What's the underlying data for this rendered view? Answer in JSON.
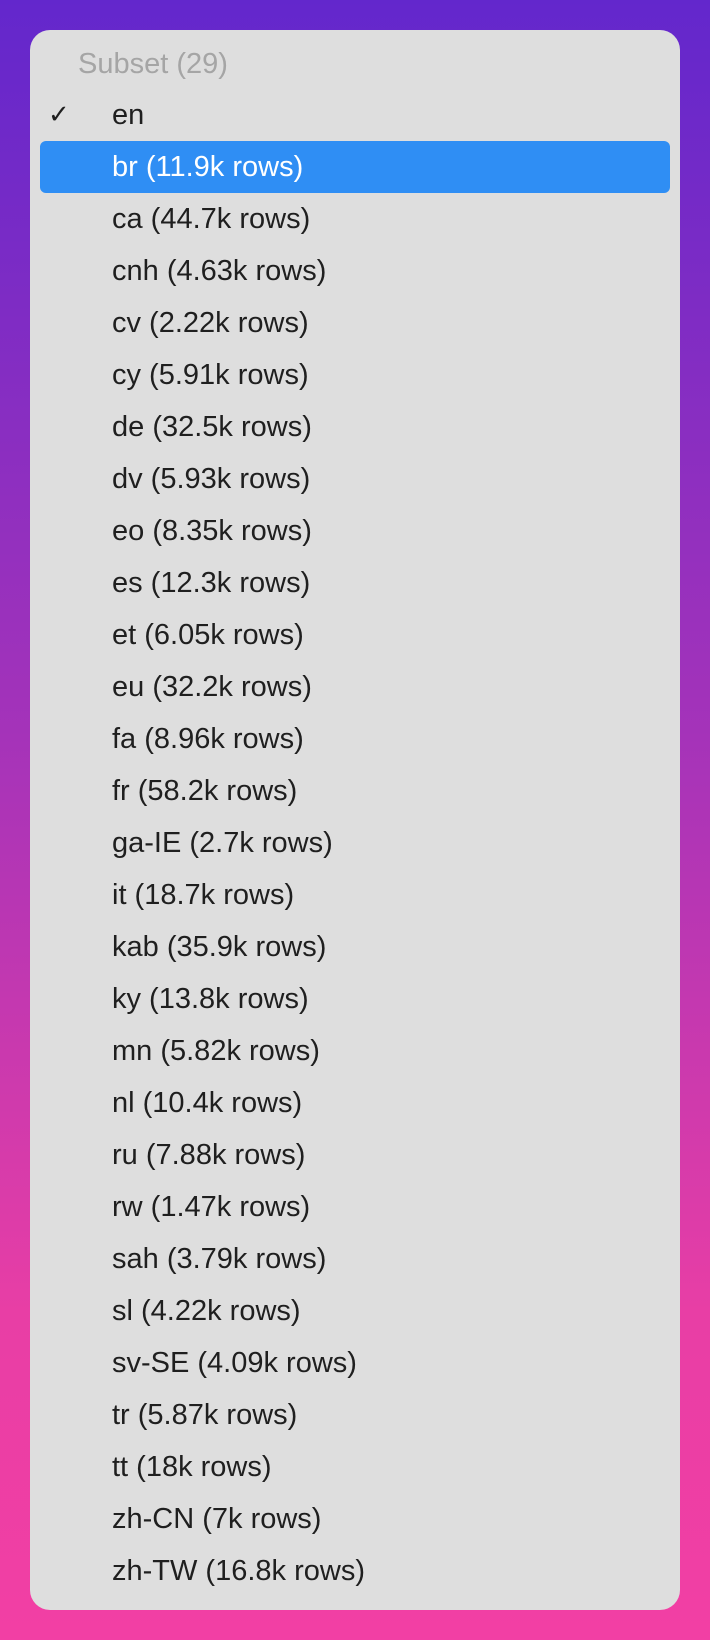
{
  "dropdown": {
    "header": "Subset (29)",
    "checked_index": 0,
    "highlighted_index": 1,
    "check_glyph": "✓",
    "colors": {
      "panel": "#DEDEDE",
      "highlight": "#2F8EF4",
      "text": "#1F1F1F",
      "header_text": "#A5A5A5",
      "background_top": "#6327CC",
      "background_bottom": "#F23FA4"
    },
    "items": [
      {
        "label": "en"
      },
      {
        "label": "br (11.9k rows)"
      },
      {
        "label": "ca (44.7k rows)"
      },
      {
        "label": "cnh (4.63k rows)"
      },
      {
        "label": "cv (2.22k rows)"
      },
      {
        "label": "cy (5.91k rows)"
      },
      {
        "label": "de (32.5k rows)"
      },
      {
        "label": "dv (5.93k rows)"
      },
      {
        "label": "eo (8.35k rows)"
      },
      {
        "label": "es (12.3k rows)"
      },
      {
        "label": "et (6.05k rows)"
      },
      {
        "label": "eu (32.2k rows)"
      },
      {
        "label": "fa (8.96k rows)"
      },
      {
        "label": "fr (58.2k rows)"
      },
      {
        "label": "ga-IE (2.7k rows)"
      },
      {
        "label": "it (18.7k rows)"
      },
      {
        "label": "kab (35.9k rows)"
      },
      {
        "label": "ky (13.8k rows)"
      },
      {
        "label": "mn (5.82k rows)"
      },
      {
        "label": "nl (10.4k rows)"
      },
      {
        "label": "ru (7.88k rows)"
      },
      {
        "label": "rw (1.47k rows)"
      },
      {
        "label": "sah (3.79k rows)"
      },
      {
        "label": "sl (4.22k rows)"
      },
      {
        "label": "sv-SE (4.09k rows)"
      },
      {
        "label": "tr (5.87k rows)"
      },
      {
        "label": "tt (18k rows)"
      },
      {
        "label": "zh-CN (7k rows)"
      },
      {
        "label": "zh-TW (16.8k rows)"
      }
    ]
  }
}
